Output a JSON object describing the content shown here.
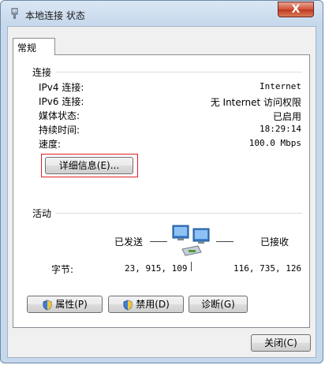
{
  "window": {
    "title": "本地连接 状态",
    "close_label": "X"
  },
  "tabs": [
    {
      "label": "常规"
    }
  ],
  "connection": {
    "group_label": "连接",
    "rows": [
      {
        "label": "IPv4 连接:",
        "value": "Internet"
      },
      {
        "label": "IPv6 连接:",
        "value": "无 Internet 访问权限"
      },
      {
        "label": "媒体状态:",
        "value": "已启用"
      },
      {
        "label": "持续时间:",
        "value": "18:29:14"
      },
      {
        "label": "速度:",
        "value": "100.0 Mbps"
      }
    ],
    "details_button": "详细信息(E)..."
  },
  "activity": {
    "group_label": "活动",
    "sent_label": "已发送",
    "received_label": "已接收",
    "bytes_label": "字节:",
    "bytes_sent": "23, 915, 109",
    "bytes_received": "116, 735, 126",
    "network_icon": "network-computers-icon"
  },
  "buttons": {
    "properties": "属性(P)",
    "disable": "禁用(D)",
    "diagnose": "诊断(G)",
    "close": "关闭(C)"
  },
  "colors": {
    "highlight": "#e02020",
    "close_red": "#c0391d"
  }
}
